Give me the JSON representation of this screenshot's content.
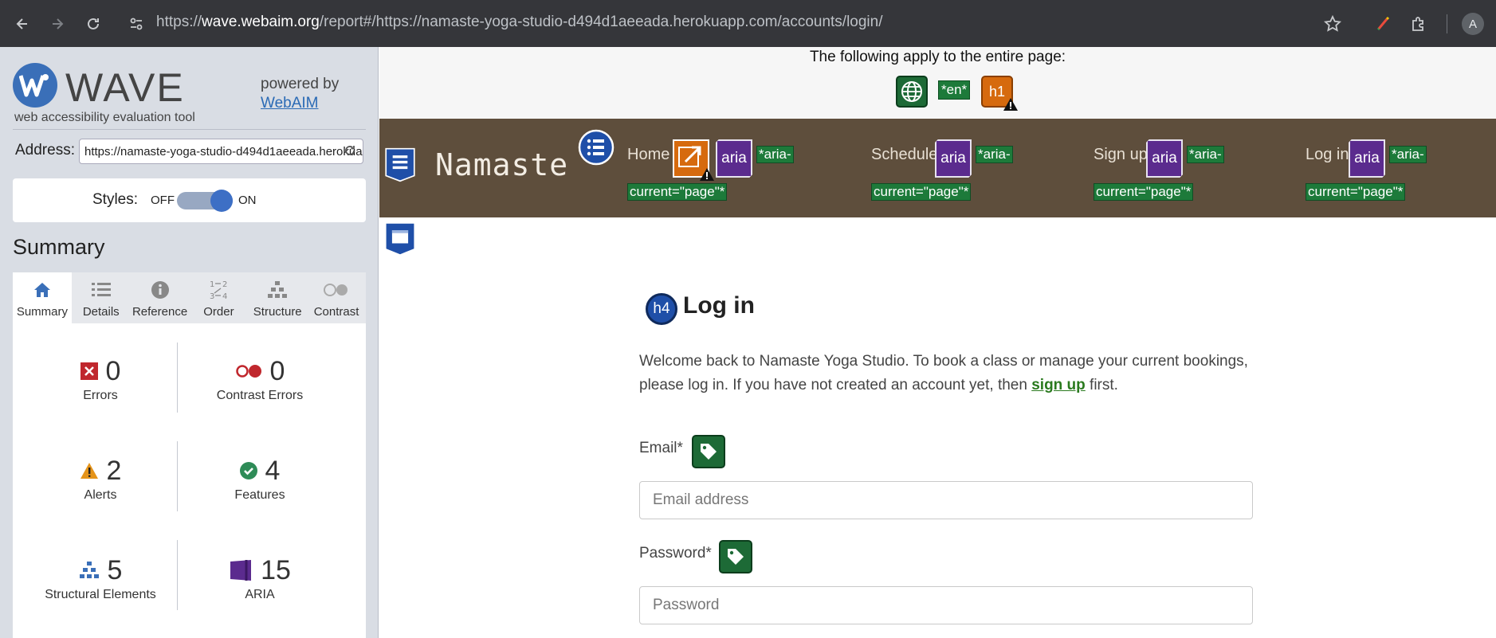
{
  "browser": {
    "url_prefix": "https://",
    "url_domain": "wave.webaim.org",
    "url_rest": "/report#/https://namaste-yoga-studio-d494d1aeeada.herokuapp.com/accounts/login/",
    "avatar_letter": "A"
  },
  "wave": {
    "title": "WAVE",
    "subtitle": "web accessibility evaluation tool",
    "powered_by": "powered by",
    "webaim_link": "WebAIM",
    "address_label": "Address:",
    "address_value": "https://namaste-yoga-studio-d494d1aeeada.herokuapp.com/accounts/login/",
    "styles_label": "Styles:",
    "styles_off": "OFF",
    "styles_on": "ON",
    "styles_state": "on",
    "summary_heading": "Summary",
    "tabs": [
      {
        "label": "Summary",
        "icon": "home-icon",
        "active": true
      },
      {
        "label": "Details",
        "icon": "list-icon",
        "active": false
      },
      {
        "label": "Reference",
        "icon": "info-icon",
        "active": false
      },
      {
        "label": "Order",
        "icon": "order-icon",
        "active": false
      },
      {
        "label": "Structure",
        "icon": "structure-icon",
        "active": false
      },
      {
        "label": "Contrast",
        "icon": "contrast-icon",
        "active": false
      }
    ],
    "stats": {
      "errors": {
        "count": "0",
        "label": "Errors",
        "color": "#c0272d"
      },
      "contrast_errors": {
        "count": "0",
        "label": "Contrast Errors",
        "color": "#c0272d"
      },
      "alerts": {
        "count": "2",
        "label": "Alerts",
        "color": "#e5941a"
      },
      "features": {
        "count": "4",
        "label": "Features",
        "color": "#2e8b57"
      },
      "structural": {
        "count": "5",
        "label": "Structural Elements",
        "color": "#3a6fb8"
      },
      "aria": {
        "count": "15",
        "label": "ARIA",
        "color": "#5b2b8e"
      }
    }
  },
  "page": {
    "entire_page_text": "The following apply to the entire page:",
    "lang_tag": "*en*",
    "h1_badge": "h1",
    "brand": "Namaste",
    "nav": [
      {
        "label": "Home",
        "aria": "aria",
        "aria_current_1": "*aria-",
        "aria_current_2": "current=\"page\"*"
      },
      {
        "label": "Schedule",
        "aria": "aria",
        "aria_current_1": "*aria-",
        "aria_current_2": "current=\"page\"*"
      },
      {
        "label": "Sign up",
        "aria": "aria",
        "aria_current_1": "*aria-",
        "aria_current_2": "current=\"page\"*"
      },
      {
        "label": "Log in",
        "aria": "aria",
        "aria_current_1": "*aria-",
        "aria_current_2": "current=\"page\"*"
      }
    ],
    "h4_badge": "h4",
    "login_heading": "Log in",
    "welcome_1": "Welcome back to Namaste Yoga Studio. To book a class or manage your current bookings,",
    "welcome_2a": "please log in. If you have not created an account yet, then ",
    "signup_link": "sign up",
    "welcome_2b": " first.",
    "email_label": "Email*",
    "email_placeholder": "Email address",
    "password_label": "Password*",
    "password_placeholder": "Password"
  }
}
